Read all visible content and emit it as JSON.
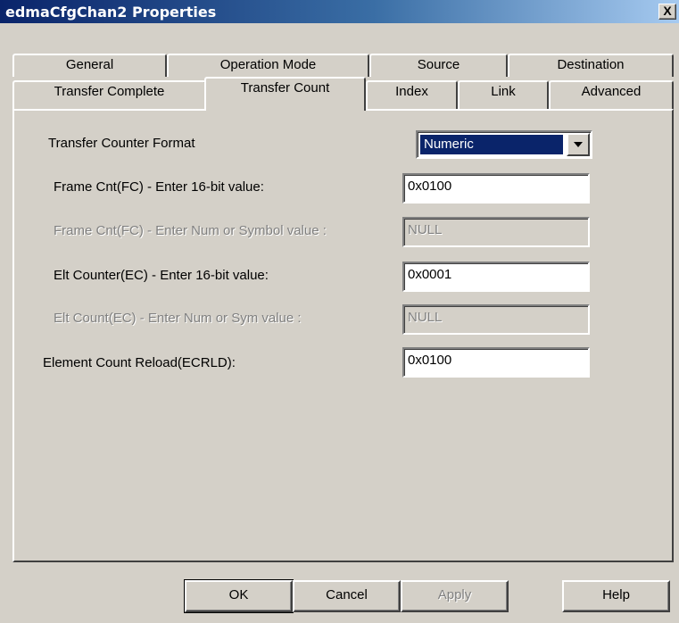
{
  "window": {
    "title": "edmaCfgChan2 Properties",
    "close_label": "X"
  },
  "tabs_back": [
    "General",
    "Operation Mode",
    "Source",
    "Destination"
  ],
  "tabs_front": [
    "Transfer Complete",
    "Transfer Count",
    "Index",
    "Link",
    "Advanced"
  ],
  "active_tab": "Transfer Count",
  "form": {
    "format_label": "Transfer Counter Format",
    "format_value": "Numeric",
    "frame_cnt_label": "Frame Cnt(FC) - Enter 16-bit value:",
    "frame_cnt_value": "0x0100",
    "frame_sym_label": "Frame Cnt(FC) - Enter Num or Symbol value :",
    "frame_sym_value": "NULL",
    "elt_counter_label": "Elt Counter(EC) - Enter 16-bit value:",
    "elt_counter_value": "0x0001",
    "elt_sym_label": "Elt Count(EC) - Enter  Num or Sym value :",
    "elt_sym_value": "NULL",
    "ecrld_label": "Element Count Reload(ECRLD):",
    "ecrld_value": "0x0100"
  },
  "buttons": {
    "ok": "OK",
    "cancel": "Cancel",
    "apply": "Apply",
    "help": "Help"
  }
}
